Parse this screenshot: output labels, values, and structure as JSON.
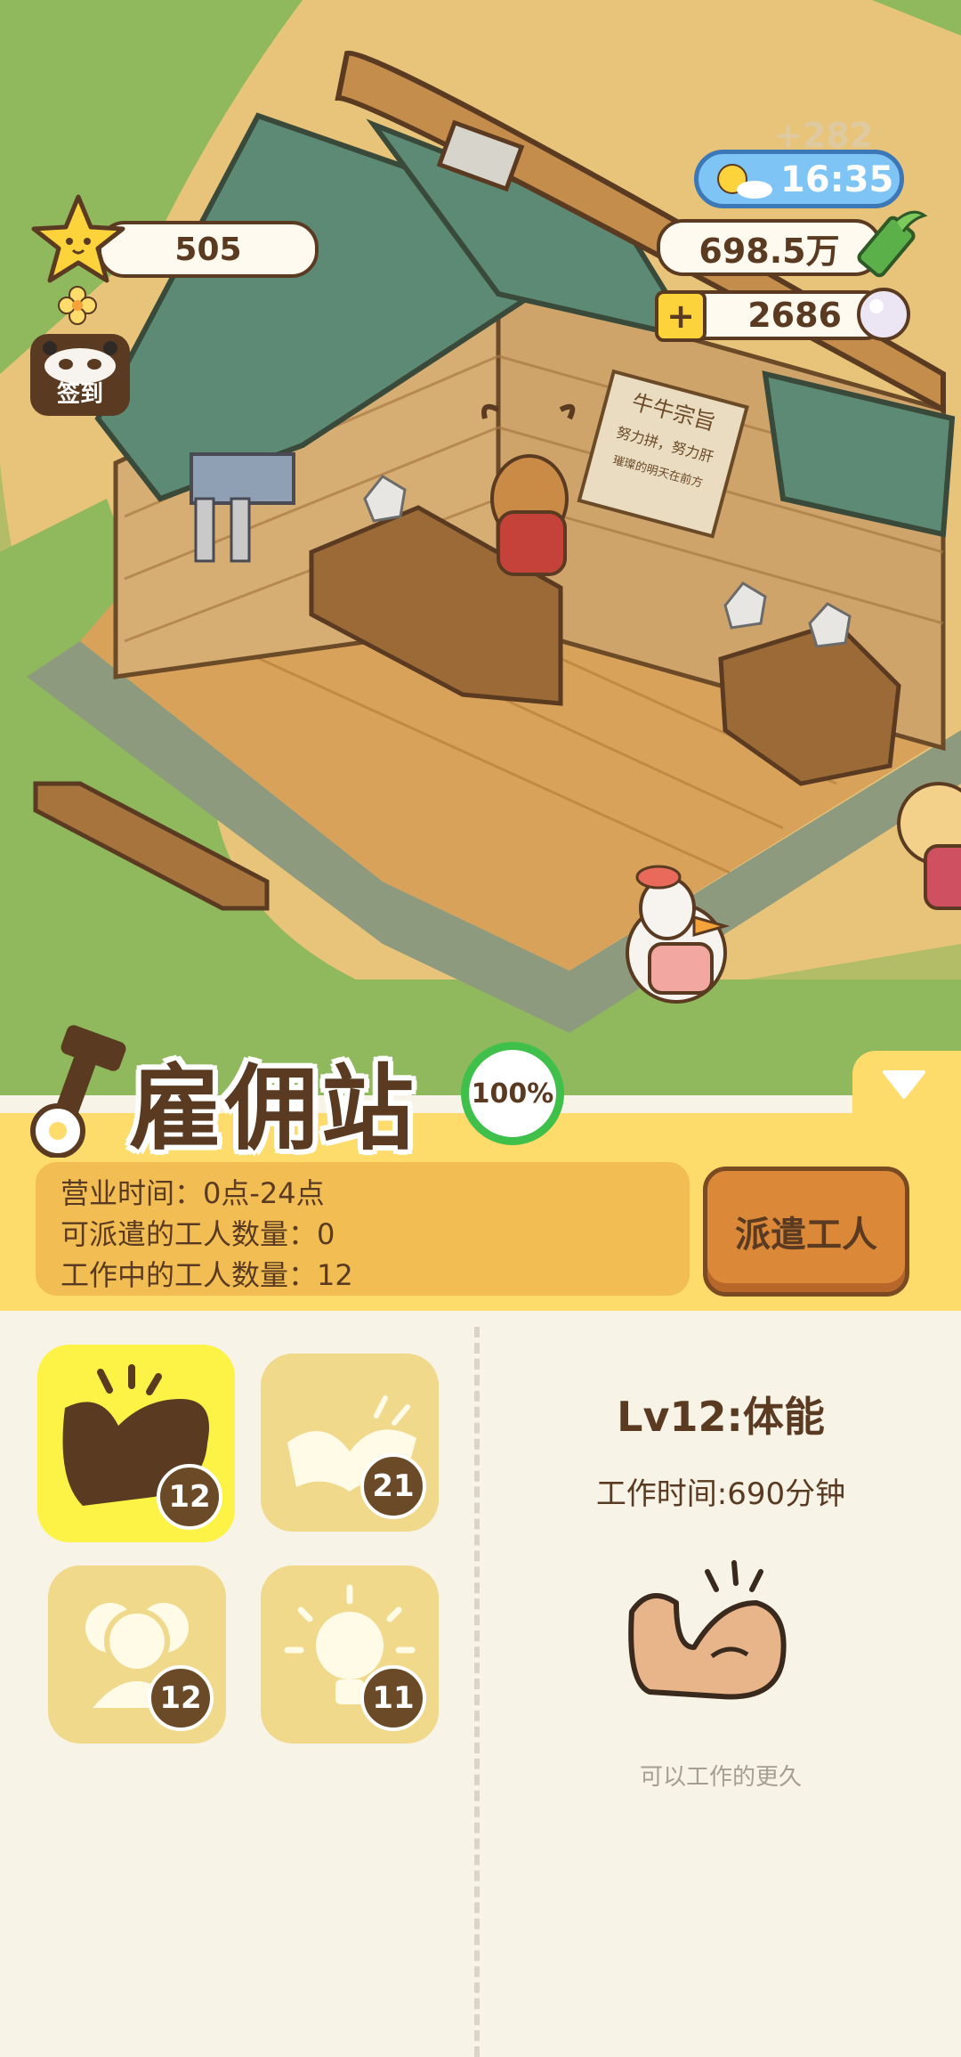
{
  "hud": {
    "star_count": "505",
    "checkin_label": "签到",
    "clock": "16:35",
    "ghost_bonus": "+282",
    "money": "698.5万",
    "pearls": "2686",
    "plus_symbol": "+"
  },
  "scene": {
    "sign_lines": [
      "牛牛宗旨",
      "努力拼，努力肝",
      "璀璨的明天在前方"
    ]
  },
  "station": {
    "title": "雇佣站",
    "progress": "100%",
    "progress_value": 100,
    "hours_line": "营业时间：0点-24点",
    "available_line": "可派遣的工人数量：0",
    "working_line": "工作中的工人数量：12",
    "dispatch_button": "派遣工人"
  },
  "skills": [
    {
      "name": "stamina",
      "icon": "muscle-icon",
      "level": "12",
      "active": true
    },
    {
      "name": "knowledge",
      "icon": "book-icon",
      "level": "21",
      "active": false
    },
    {
      "name": "social",
      "icon": "people-icon",
      "level": "12",
      "active": false
    },
    {
      "name": "idea",
      "icon": "lightbulb-icon",
      "level": "11",
      "active": false
    }
  ],
  "detail": {
    "title": "Lv12:体能",
    "work_time": "工作时间:690分钟",
    "description": "可以工作的更久"
  },
  "colors": {
    "panel_yellow": "#fddc6b",
    "active_skill": "#fdf346",
    "inactive_skill": "#f0d98a",
    "button_orange": "#db8838",
    "text_brown": "#5a3b22",
    "progress_green": "#3ec04a"
  }
}
